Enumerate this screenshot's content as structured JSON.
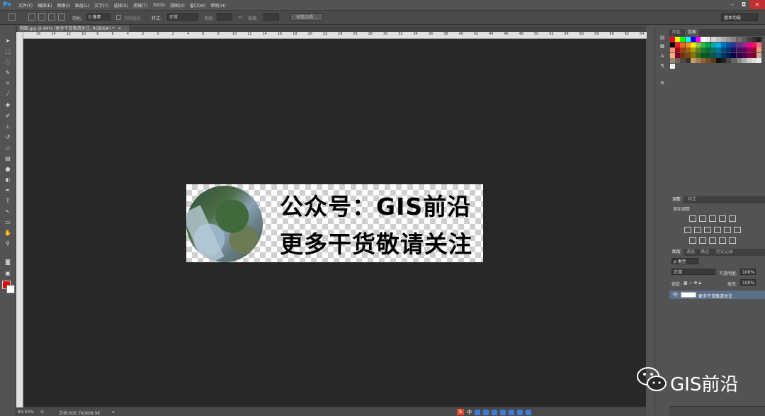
{
  "app": {
    "logo": "Ps"
  },
  "menu": [
    "文件(F)",
    "编辑(E)",
    "图像(I)",
    "图层(L)",
    "文字(Y)",
    "选择(S)",
    "滤镜(T)",
    "3D(D)",
    "视图(V)",
    "窗口(W)",
    "帮助(H)"
  ],
  "window_controls": [
    "–",
    "◘",
    "✕"
  ],
  "options_bar": {
    "feather_label": "羽化:",
    "feather_value": "0 像素",
    "antialias_label": "消除锯齿",
    "style_label": "样式:",
    "style_value": "正常",
    "width_label": "宽度:",
    "height_label": "高度:",
    "refine_button": "调整边缘...",
    "workspace": "基本功能"
  },
  "document": {
    "tab_title": "制图.jpg @ 84% (更多干货敬请关注, RGB/8#) *",
    "tab_close": "×",
    "line1": "公众号：GIS前沿",
    "line2": "更多干货敬请关注"
  },
  "ruler": [
    "16",
    "14",
    "12",
    "10",
    "8",
    "6",
    "4",
    "2",
    "0",
    "2",
    "4",
    "6",
    "8",
    "10",
    "12",
    "14",
    "16",
    "18",
    "20",
    "22",
    "24",
    "26",
    "28",
    "30",
    "32",
    "34",
    "36",
    "38",
    "40",
    "42",
    "44",
    "46",
    "48",
    "50",
    "52",
    "54",
    "56",
    "58",
    "60",
    "62",
    "64"
  ],
  "status": {
    "zoom": "84.03%",
    "doc_info": "文档:606.7K/808.9K"
  },
  "ime": {
    "logo": "S",
    "lang": "中"
  },
  "panels": {
    "color_tabs": [
      "颜色",
      "色板"
    ],
    "adjust_tabs": [
      "调整",
      "样式"
    ],
    "adjust_title": "添加调整",
    "layers_tabs": [
      "图层",
      "通道",
      "路径",
      "历史记录"
    ],
    "kind_filter": "ρ 类型",
    "blend_mode": "正常",
    "opacity_label": "不透明度:",
    "opacity_value": "100%",
    "lock_label": "锁定:",
    "fill_label": "填充:",
    "fill_value": "100%",
    "layer_name": "更多干货敬请关注"
  },
  "watermark": {
    "text": "GIS前沿"
  },
  "colors": {
    "foreground": "#e60000",
    "background": "#ffffff",
    "canvas": "#282828",
    "chrome": "#535353",
    "layer_selected": "#5b6e8a"
  },
  "icons": [
    "move-icon",
    "marquee-icon",
    "lasso-icon",
    "quick-select-icon",
    "crop-icon",
    "eyedropper-icon",
    "healing-icon",
    "brush-icon",
    "stamp-icon",
    "history-brush-icon",
    "eraser-icon",
    "gradient-icon",
    "blur-icon",
    "dodge-icon",
    "pen-icon",
    "type-icon",
    "path-select-icon",
    "shape-icon",
    "hand-icon",
    "zoom-icon",
    "eye-icon",
    "wechat-icon"
  ]
}
